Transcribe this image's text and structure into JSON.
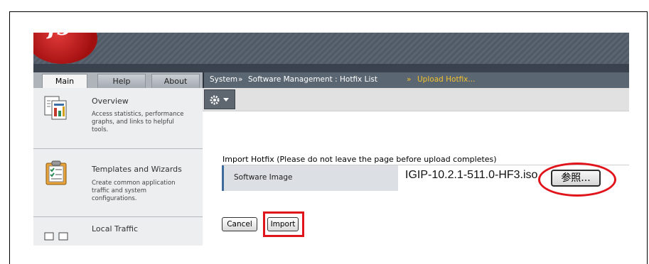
{
  "nav": {
    "tabs": [
      "Main",
      "Help",
      "About"
    ],
    "sections": [
      {
        "title": "Overview",
        "desc": "Access statistics, performance graphs, and links to helpful tools.",
        "icon": "document-chart-icon"
      },
      {
        "title": "Templates and Wizards",
        "desc": "Create common application traffic and system configurations.",
        "icon": "clipboard-checklist-icon"
      },
      {
        "title": "Local Traffic",
        "icon": "network-icon"
      }
    ]
  },
  "breadcrumb": {
    "parts": [
      "System",
      "Software Management : Hotfix List"
    ],
    "separator": "»",
    "current": "Upload Hotfix..."
  },
  "toolbar": {
    "gear_icon": "gear-icon",
    "chevron_icon": "chevron-down-icon"
  },
  "import": {
    "section_title": "Import Hotfix (Please do not leave the page before upload completes)",
    "field_label": "Software Image",
    "file_value": "IGIP-10.2.1-511.0-HF3.iso",
    "browse_label": "参照..."
  },
  "buttons": {
    "cancel": "Cancel",
    "import": "Import"
  },
  "colors": {
    "highlight": "#e0141b",
    "crumb_current": "#f2c12e",
    "banner": "#4f5a66"
  }
}
